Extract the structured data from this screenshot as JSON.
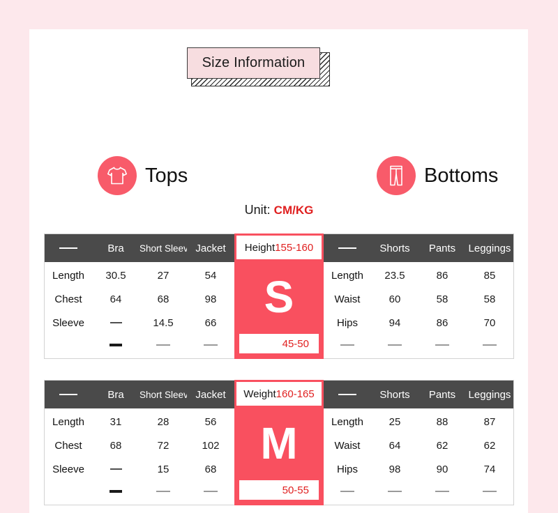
{
  "banner": {
    "title": "Size Information"
  },
  "categories": [
    {
      "label": "Tops",
      "icon": "tshirt-icon"
    },
    {
      "label": "Bottoms",
      "icon": "pants-icon"
    }
  ],
  "unit": {
    "label": "Unit:",
    "value": "CM/KG"
  },
  "blocks": [
    {
      "size": "S",
      "center_head_key": "Height",
      "center_head_value": "155-160",
      "center_foot": "45-50",
      "left": {
        "headers": [
          "—",
          "Bra",
          "Short Sleeve",
          "Jacket"
        ],
        "rows": [
          {
            "label": "Length",
            "values": [
              "30.5",
              "27",
              "54"
            ]
          },
          {
            "label": "Chest",
            "values": [
              "64",
              "68",
              "98"
            ]
          },
          {
            "label": "Sleeve",
            "values": [
              "—",
              "14.5",
              "66"
            ]
          }
        ]
      },
      "right": {
        "headers": [
          "—",
          "Shorts",
          "Pants",
          "Leggings"
        ],
        "rows": [
          {
            "label": "Length",
            "values": [
              "23.5",
              "86",
              "85"
            ]
          },
          {
            "label": "Waist",
            "values": [
              "60",
              "58",
              "58"
            ]
          },
          {
            "label": "Hips",
            "values": [
              "94",
              "86",
              "70"
            ]
          }
        ]
      }
    },
    {
      "size": "M",
      "center_head_key": "Weight",
      "center_head_value": "160-165",
      "center_foot": "50-55",
      "left": {
        "headers": [
          "—",
          "Bra",
          "Short Sleeve",
          "Jacket"
        ],
        "rows": [
          {
            "label": "Length",
            "values": [
              "31",
              "28",
              "56"
            ]
          },
          {
            "label": "Chest",
            "values": [
              "68",
              "72",
              "102"
            ]
          },
          {
            "label": "Sleeve",
            "values": [
              "—",
              "15",
              "68"
            ]
          }
        ]
      },
      "right": {
        "headers": [
          "—",
          "Shorts",
          "Pants",
          "Leggings"
        ],
        "rows": [
          {
            "label": "Length",
            "values": [
              "25",
              "88",
              "87"
            ]
          },
          {
            "label": "Waist",
            "values": [
              "64",
              "62",
              "62"
            ]
          },
          {
            "label": "Hips",
            "values": [
              "98",
              "90",
              "74"
            ]
          }
        ]
      }
    }
  ],
  "colors": {
    "page_border": "#fde8ec",
    "accent_red": "#f9505f",
    "header_gray": "#4a4a4a",
    "value_red": "#e02020",
    "banner_fill": "#f7dde0"
  }
}
